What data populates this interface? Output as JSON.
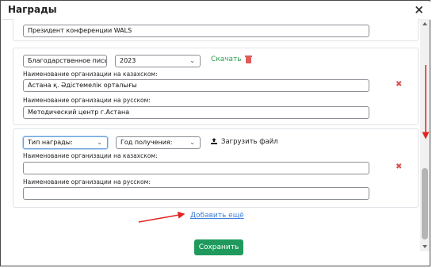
{
  "window": {
    "title": "Награды",
    "close_label": "×"
  },
  "top_field": {
    "value": "Президент конференции WALS"
  },
  "award1": {
    "type": "Благодарственное письмо",
    "year": "2023",
    "download": "Скачать",
    "label_kz": "Наименование организации на казахском:",
    "value_kz": "Астана қ. Әдістемелік орталығы",
    "label_ru": "Наименование организации на русском:",
    "value_ru": "Методический центр г.Астана"
  },
  "award2": {
    "type_placeholder": "Тип награды:",
    "year_placeholder": "Год получения:",
    "upload": "Загрузить файл",
    "label_kz": "Наименование организации на казахском:",
    "value_kz": "",
    "label_ru": "Наименование организации на русском:",
    "value_ru": ""
  },
  "add_more": "Добавить ещё",
  "save": "Сохранить",
  "icons": {
    "delete": "x-icon",
    "trash": "trash-icon",
    "upload": "upload-icon"
  },
  "colors": {
    "accent_green": "#1f9a5c",
    "link_blue": "#3b7fd6",
    "danger": "#d9534f",
    "annotation_red": "#e32222"
  }
}
